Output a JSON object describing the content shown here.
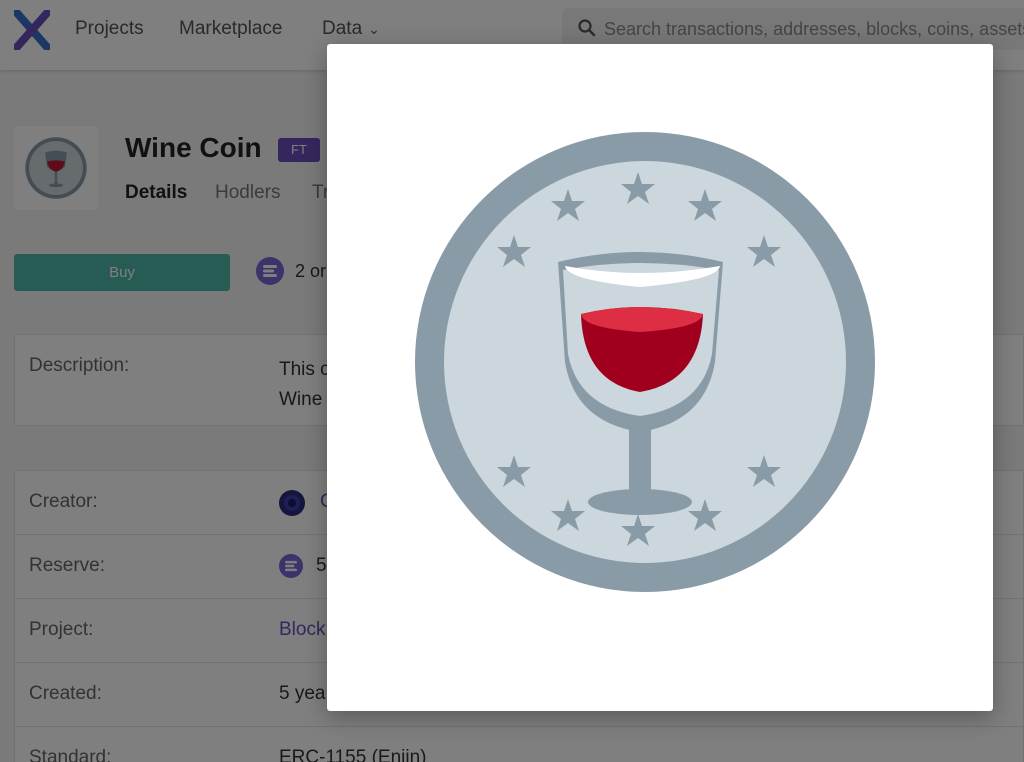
{
  "nav": {
    "projects": "Projects",
    "marketplace": "Marketplace",
    "data": "Data",
    "search_placeholder": "Search transactions, addresses, blocks, coins, assets"
  },
  "token": {
    "name": "Wine Coin",
    "badge": "FT",
    "tabs": [
      "Details",
      "Hodlers",
      "Tr"
    ]
  },
  "actions": {
    "buy_label": "Buy",
    "supply_text": "2 or"
  },
  "description": {
    "label": "Description:",
    "value": "This c Wine"
  },
  "details": [
    {
      "label": "Creator:",
      "value": "C"
    },
    {
      "label": "Reserve:",
      "value": "5"
    },
    {
      "label": "Project:",
      "value": "Block"
    },
    {
      "label": "Created:",
      "value": "5 yea"
    },
    {
      "label": "Standard:",
      "value": "ERC-1155 (Enjin)"
    }
  ],
  "colors": {
    "brand_purple": "#6b4fbb",
    "buy_green": "#4db8a8",
    "coin_gray": "#8a9ba8",
    "coin_face": "#ccd6dd",
    "wine_red": "#be1931"
  },
  "modal": {
    "image": "wine-coin-icon"
  }
}
